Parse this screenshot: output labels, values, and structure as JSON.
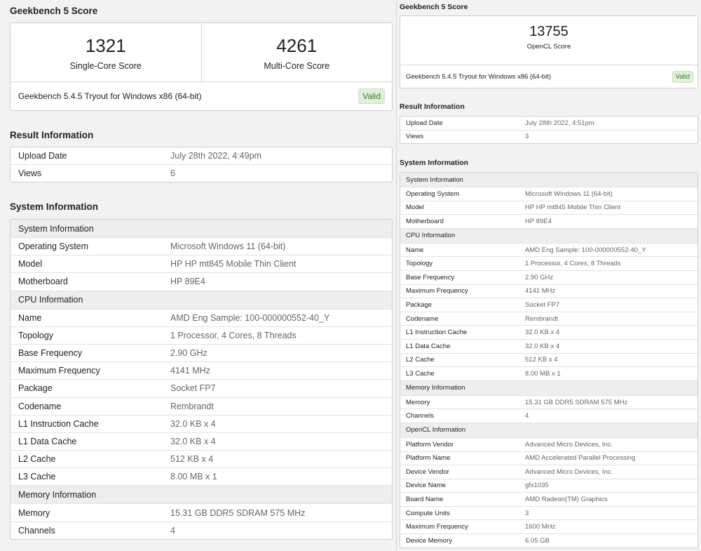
{
  "left": {
    "score_title": "Geekbench 5 Score",
    "single_score": "1321",
    "single_label": "Single-Core Score",
    "multi_score": "4261",
    "multi_label": "Multi-Core Score",
    "version": "Geekbench 5.4.5 Tryout for Windows x86 (64-bit)",
    "valid": "Valid",
    "result_title": "Result Information",
    "result_rows": [
      {
        "k": "Upload Date",
        "v": "July 28th 2022, 4:49pm"
      },
      {
        "k": "Views",
        "v": "6"
      }
    ],
    "system_title": "System Information",
    "system_rows": [
      {
        "hdr": "System Information"
      },
      {
        "k": "Operating System",
        "v": "Microsoft Windows 11 (64-bit)"
      },
      {
        "k": "Model",
        "v": "HP HP mt845 Mobile Thin Client"
      },
      {
        "k": "Motherboard",
        "v": "HP 89E4"
      },
      {
        "hdr": "CPU Information"
      },
      {
        "k": "Name",
        "v": "AMD Eng Sample: 100-000000552-40_Y"
      },
      {
        "k": "Topology",
        "v": "1 Processor, 4 Cores, 8 Threads"
      },
      {
        "k": "Base Frequency",
        "v": "2.90 GHz"
      },
      {
        "k": "Maximum Frequency",
        "v": "4141 MHz"
      },
      {
        "k": "Package",
        "v": "Socket FP7"
      },
      {
        "k": "Codename",
        "v": "Rembrandt"
      },
      {
        "k": "L1 Instruction Cache",
        "v": "32.0 KB x 4"
      },
      {
        "k": "L1 Data Cache",
        "v": "32.0 KB x 4"
      },
      {
        "k": "L2 Cache",
        "v": "512 KB x 4"
      },
      {
        "k": "L3 Cache",
        "v": "8.00 MB x 1"
      },
      {
        "hdr": "Memory Information"
      },
      {
        "k": "Memory",
        "v": "15.31 GB DDR5 SDRAM 575 MHz"
      },
      {
        "k": "Channels",
        "v": "4"
      }
    ]
  },
  "right": {
    "score_title": "Geekbench 5 Score",
    "opencl_score": "13755",
    "opencl_label": "OpenCL Score",
    "version": "Geekbench 5.4.5 Tryout for Windows x86 (64-bit)",
    "valid": "Valid",
    "result_title": "Result Information",
    "result_rows": [
      {
        "k": "Upload Date",
        "v": "July 28th 2022, 4:51pm"
      },
      {
        "k": "Views",
        "v": "3"
      }
    ],
    "system_title": "System Information",
    "system_rows": [
      {
        "hdr": "System Information"
      },
      {
        "k": "Operating System",
        "v": "Microsoft Windows 11 (64-bit)"
      },
      {
        "k": "Model",
        "v": "HP HP mt845 Mobile Thin Client"
      },
      {
        "k": "Motherboard",
        "v": "HP 89E4"
      },
      {
        "hdr": "CPU Information"
      },
      {
        "k": "Name",
        "v": "AMD Eng Sample: 100-000000552-40_Y"
      },
      {
        "k": "Topology",
        "v": "1 Processor, 4 Cores, 8 Threads"
      },
      {
        "k": "Base Frequency",
        "v": "2.90 GHz"
      },
      {
        "k": "Maximum Frequency",
        "v": "4141 MHz"
      },
      {
        "k": "Package",
        "v": "Socket FP7"
      },
      {
        "k": "Codename",
        "v": "Rembrandt"
      },
      {
        "k": "L1 Instruction Cache",
        "v": "32.0 KB x 4"
      },
      {
        "k": "L1 Data Cache",
        "v": "32.0 KB x 4"
      },
      {
        "k": "L2 Cache",
        "v": "512 KB x 4"
      },
      {
        "k": "L3 Cache",
        "v": "8.00 MB x 1"
      },
      {
        "hdr": "Memory Information"
      },
      {
        "k": "Memory",
        "v": "15.31 GB DDR5 SDRAM 575 MHz"
      },
      {
        "k": "Channels",
        "v": "4"
      },
      {
        "hdr": "OpenCL Information"
      },
      {
        "k": "Platform Vendor",
        "v": "Advanced Micro Devices, Inc."
      },
      {
        "k": "Platform Name",
        "v": "AMD Accelerated Parallel Processing"
      },
      {
        "k": "Device Vendor",
        "v": "Advanced Micro Devices, Inc."
      },
      {
        "k": "Device Name",
        "v": "gfx1035"
      },
      {
        "k": "Board Name",
        "v": "AMD Radeon(TM) Graphics"
      },
      {
        "k": "Compute Units",
        "v": "3"
      },
      {
        "k": "Maximum Frequency",
        "v": "1600 MHz"
      },
      {
        "k": "Device Memory",
        "v": "6.05 GB"
      }
    ]
  }
}
